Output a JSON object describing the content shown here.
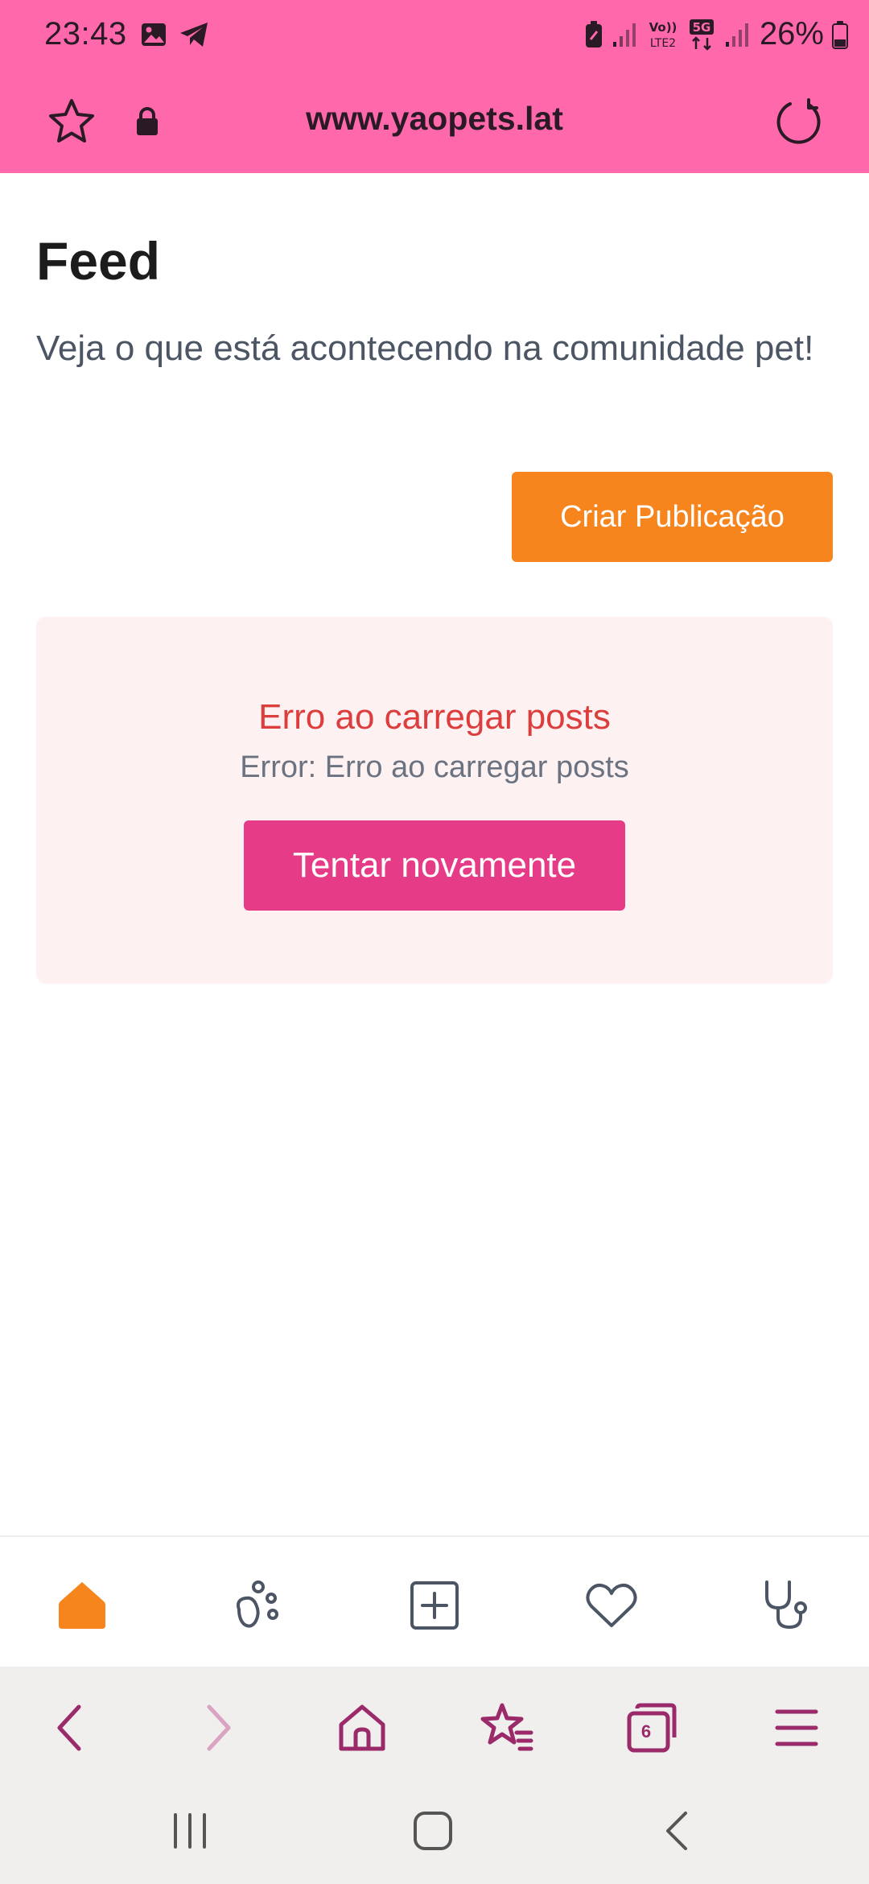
{
  "status_bar": {
    "time": "23:43",
    "battery_percent": "26%",
    "network_label": "5G",
    "volte_label": "Vo)) LTE2",
    "icons": [
      "image-icon",
      "telegram-icon",
      "battery-saver-icon",
      "signal-icon",
      "volte-icon",
      "5g-icon",
      "signal-icon",
      "battery-icon"
    ]
  },
  "browser": {
    "url": "www.yaopets.lat",
    "icons": [
      "star-icon",
      "lock-icon",
      "reload-icon"
    ],
    "tab_count": "6",
    "toolbar": [
      "back-icon",
      "forward-icon",
      "home-icon",
      "bookmarks-icon",
      "tabs-icon",
      "menu-icon"
    ]
  },
  "page": {
    "title": "Feed",
    "subtitle": "Veja o que está acontecendo na comunidade pet!",
    "create_button": "Criar Publicação"
  },
  "error": {
    "title": "Erro ao carregar posts",
    "detail": "Error: Erro ao carregar posts",
    "retry_button": "Tentar novamente"
  },
  "app_nav": {
    "items": [
      "home-icon",
      "paw-icon",
      "plus-square-icon",
      "heart-icon",
      "stethoscope-icon"
    ],
    "active": "home-icon"
  },
  "system_nav": [
    "recents-icon",
    "home-icon",
    "back-icon"
  ],
  "colors": {
    "topbar": "#ff69ac",
    "accent_orange": "#f6851e",
    "accent_pink": "#e63c88",
    "error_text": "#dc3d3d",
    "error_bg": "#fdf1f2",
    "browser_icon": "#9b2a6a"
  }
}
